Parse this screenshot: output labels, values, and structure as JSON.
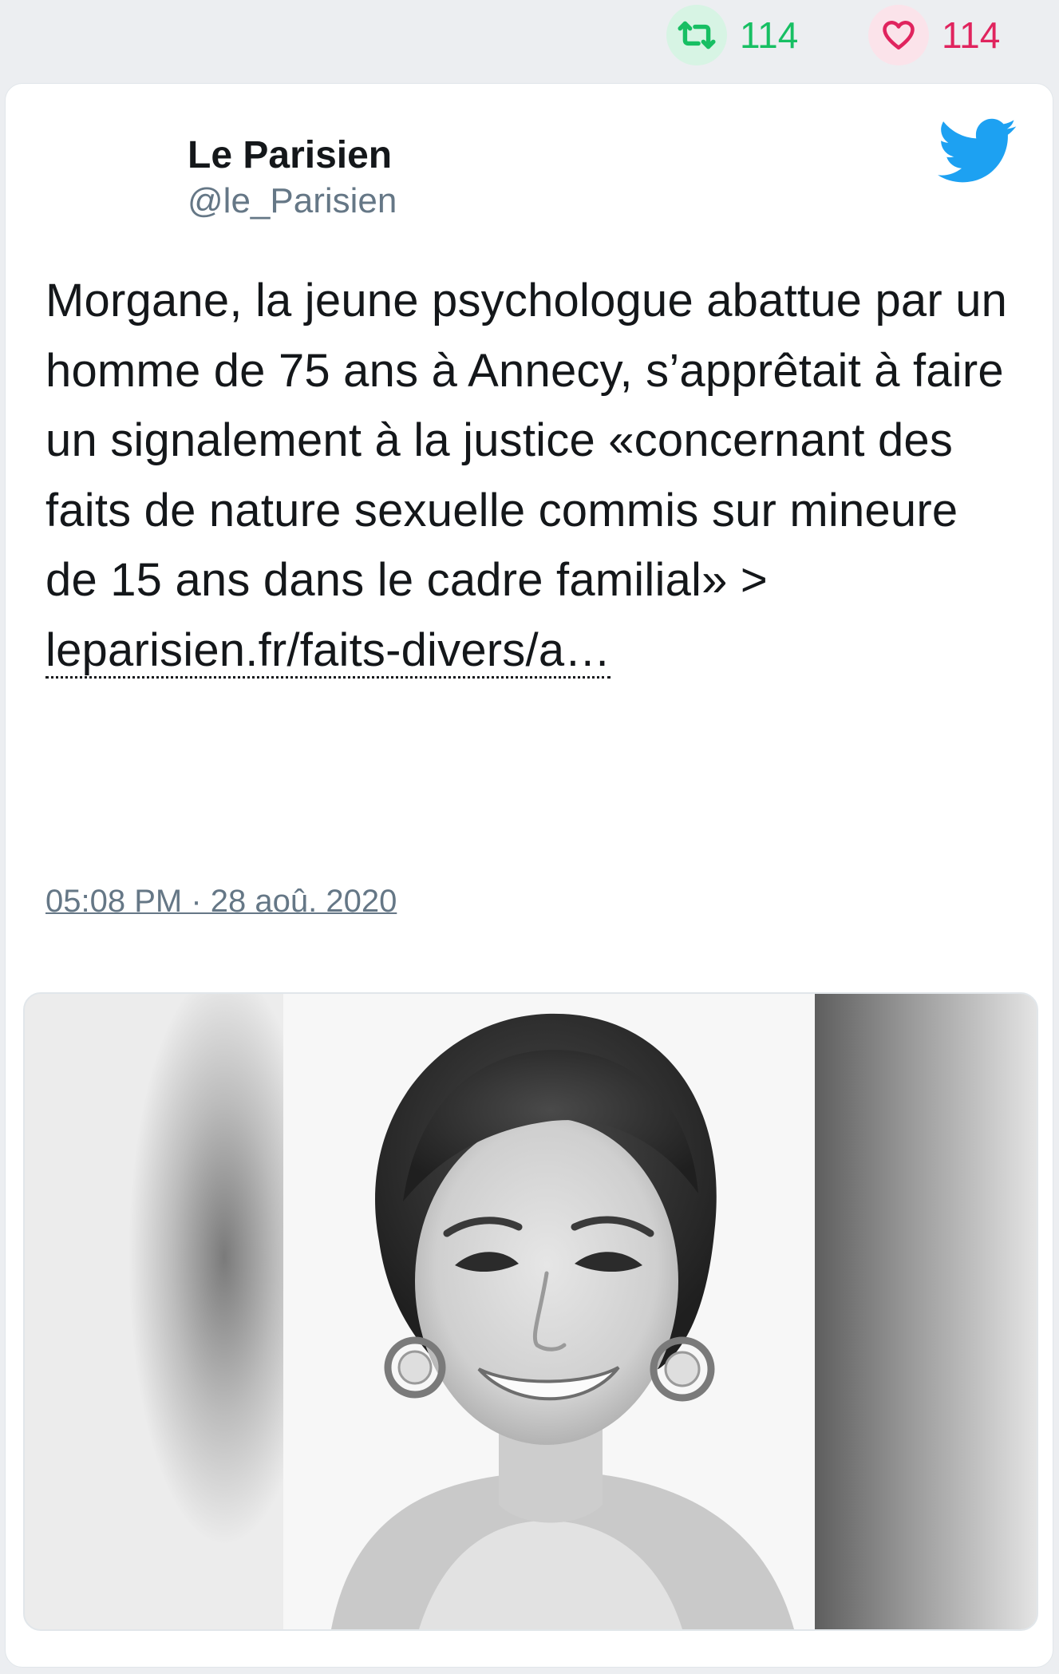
{
  "stats": {
    "retweet_icon": "retweet-icon",
    "retweet_count": "114",
    "like_icon": "heart-icon",
    "like_count": "114",
    "retweet_color": "#17bf63",
    "like_color": "#e0245e"
  },
  "tweet": {
    "author_name": "Le Parisien",
    "author_handle": "@le_Parisien",
    "platform_icon": "twitter-bird-icon",
    "text": "Morgane, la jeune psychologue abattue par un homme de 75 ans à Annecy, s’apprêtait à faire un signalement à la justice «concernant des faits de nature sexuelle commis sur mineure de 15 ans dans le cadre familial» > ",
    "link": "leparisien.fr/faits-divers/a…",
    "timestamp": "05:08 PM · 28 aoû. 2020",
    "actions": {
      "reply_icon": "reply-icon",
      "retweet_icon": "retweet-icon",
      "like_icon": "heart-icon"
    },
    "media": {
      "type": "photo",
      "style": "black-and-white portrait"
    }
  },
  "colors": {
    "page_bg": "#eceef1",
    "card_bg": "#ffffff",
    "text": "#14171a",
    "muted": "#657786",
    "twitter_blue": "#1da1f2"
  }
}
